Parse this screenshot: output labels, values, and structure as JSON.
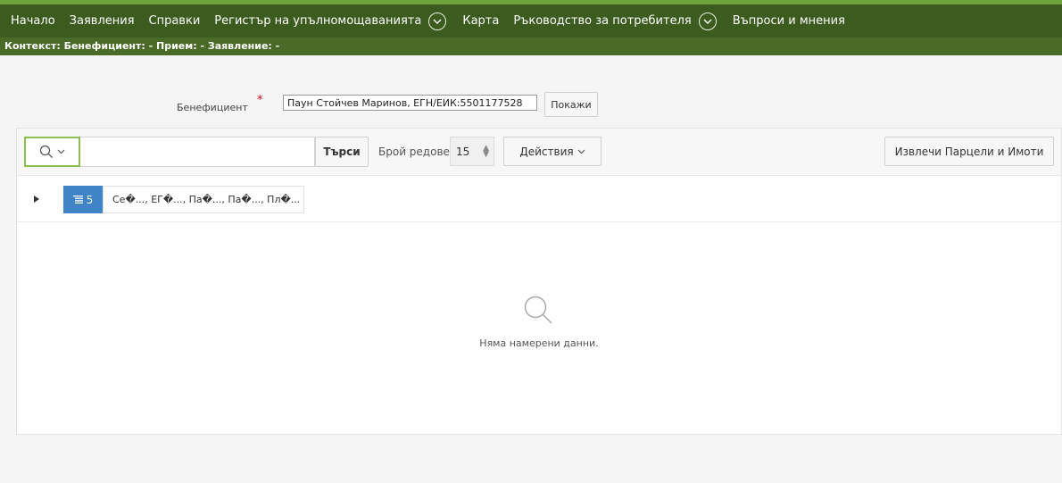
{
  "nav": {
    "items": [
      "Начало",
      "Заявления",
      "Справки",
      "Регистър на упълномощаванията"
    ],
    "map": "Карта",
    "guide": "Ръководство за потребителя",
    "faq": "Въпроси и мнения"
  },
  "context": "Контекст: Бенефициент: - Прием: - Заявление: -",
  "beneficiary": {
    "label": "Бенефициент",
    "required_mark": "*",
    "value": "Паун Стойчев Маринов, ЕГН/ЕИК:5501177528",
    "show_button": "Покажи"
  },
  "toolbar": {
    "search_button": "Търси",
    "rows_label": "Брой редове",
    "rows_value": "15",
    "actions_button": "Действия",
    "extract_button": "Извлечи Парцели и Имоти"
  },
  "filter": {
    "count": "5",
    "columns": "Се�..., ЕГ�..., Па�..., Па�..., Пл�..."
  },
  "empty_message": "Няма намерени данни.",
  "colors": {
    "header": "#3b5c1e",
    "header_stripe": "#6fa23a",
    "search_focus": "#8cc152",
    "filter_badge": "#3e84c6"
  }
}
